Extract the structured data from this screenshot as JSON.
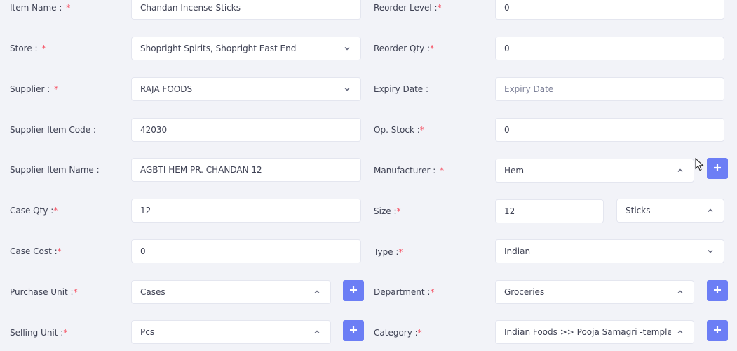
{
  "form": {
    "item_name": {
      "label": "Item Name : ",
      "value": "Chandan Incense Sticks"
    },
    "store": {
      "label": "Store : ",
      "value": "Shopright Spirits, Shopright East End"
    },
    "supplier": {
      "label": "Supplier : ",
      "value": "RAJA FOODS"
    },
    "supplier_item_code": {
      "label": "Supplier Item Code :",
      "value": "42030"
    },
    "supplier_item_name": {
      "label": "Supplier Item Name :",
      "value": "AGBTI HEM PR. CHANDAN 12"
    },
    "case_qty": {
      "label": "Case Qty :",
      "value": "12"
    },
    "case_cost": {
      "label": "Case Cost :",
      "value": "0"
    },
    "purchase_unit": {
      "label": "Purchase Unit :",
      "value": "Cases"
    },
    "selling_unit": {
      "label": "Selling Unit :",
      "value": "Pcs"
    },
    "reorder_level": {
      "label": "Reorder Level :",
      "value": "0"
    },
    "reorder_qty": {
      "label": "Reorder Qty :",
      "value": "0"
    },
    "expiry_date": {
      "label": "Expiry Date :",
      "placeholder": "Expiry Date"
    },
    "op_stock": {
      "label": "Op. Stock :",
      "value": "0"
    },
    "manufacturer": {
      "label": "Manufacturer : ",
      "value": "Hem"
    },
    "size": {
      "label": "Size :",
      "value": "12",
      "unit": "Sticks"
    },
    "type": {
      "label": "Type :",
      "value": "Indian"
    },
    "department": {
      "label": "Department :",
      "value": "Groceries"
    },
    "category": {
      "label": "Category :",
      "value": "Indian Foods >> Pooja Samagri -temples & Idols"
    },
    "required_mark": "*"
  },
  "icons": {
    "add": "plus-icon",
    "dropdown_closed": "chevron-down-icon",
    "dropdown_open": "chevron-up-icon",
    "cursor": "mouse-pointer-icon"
  },
  "colors": {
    "background": "#f2f3f8",
    "required": "#f64e60",
    "add_button": "#6c7ef5"
  }
}
